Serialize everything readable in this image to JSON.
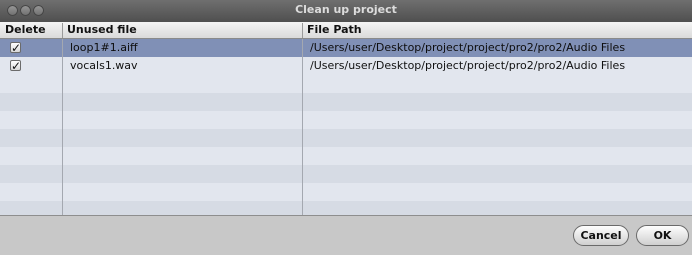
{
  "window": {
    "title": "Clean up project"
  },
  "table": {
    "columns": [
      "Delete",
      "Unused file",
      "File Path"
    ],
    "rows": [
      {
        "checked": true,
        "file": "loop1#1.aiff",
        "path": "/Users/user/Desktop/project/project/pro2/pro2/Audio Files",
        "selected": true
      },
      {
        "checked": true,
        "file": "vocals1.wav",
        "path": "/Users/user/Desktop/project/project/pro2/pro2/Audio Files",
        "selected": false
      }
    ]
  },
  "buttons": {
    "cancel": "Cancel",
    "ok": "OK"
  },
  "icons": {
    "checkmark": "checkmark-icon"
  }
}
